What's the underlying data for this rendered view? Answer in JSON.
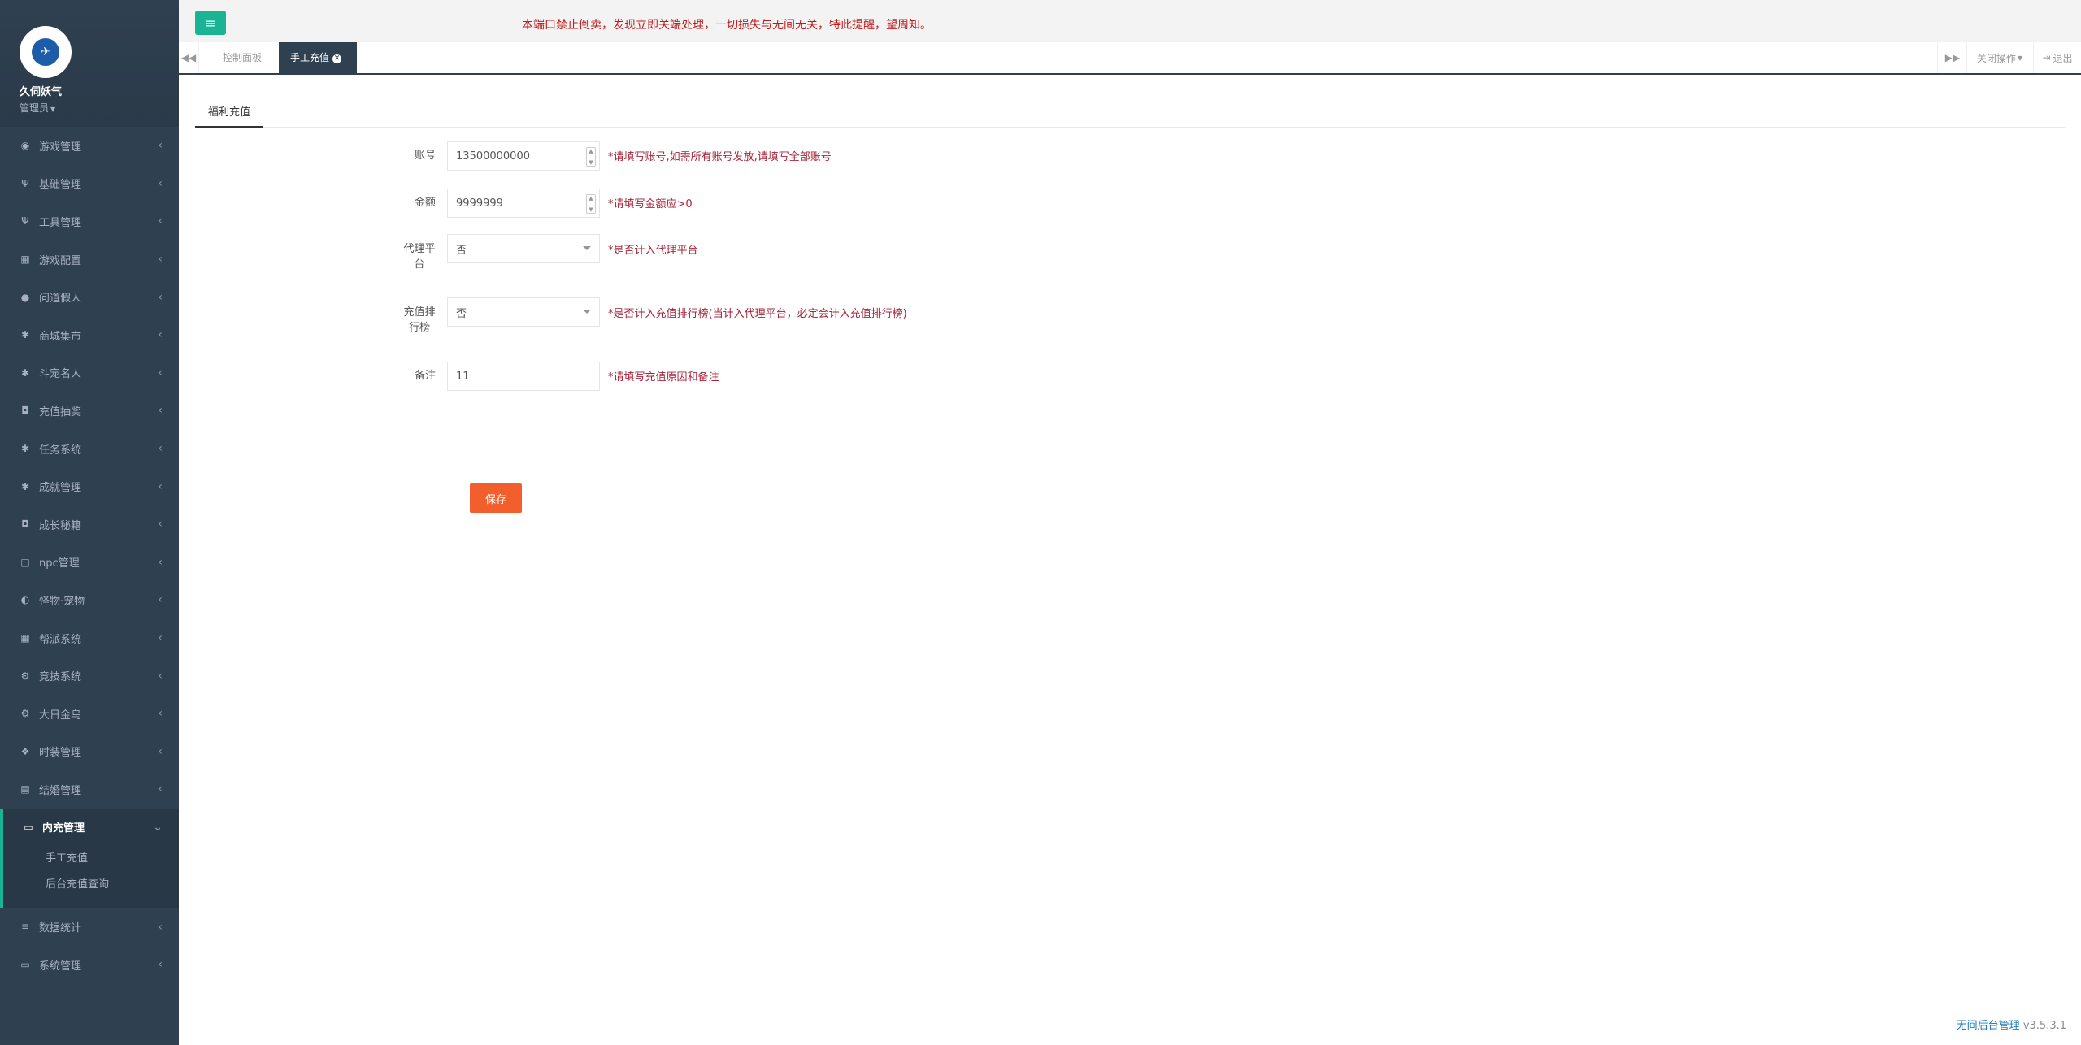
{
  "sidebar": {
    "profile": {
      "name": "久伺妖气",
      "role": "管理员"
    },
    "items": [
      {
        "icon": "gamepad-icon",
        "label": "游戏管理"
      },
      {
        "icon": "cutlery-icon",
        "label": "基础管理"
      },
      {
        "icon": "cutlery-icon",
        "label": "工具管理"
      },
      {
        "icon": "table-icon",
        "label": "游戏配置"
      },
      {
        "icon": "user-icon",
        "label": "问道假人"
      },
      {
        "icon": "gear-icon",
        "label": "商城集市"
      },
      {
        "icon": "gear-icon",
        "label": "斗宠名人"
      },
      {
        "icon": "money-icon",
        "label": "充值抽奖"
      },
      {
        "icon": "gear-icon",
        "label": "任务系统"
      },
      {
        "icon": "gear-icon",
        "label": "成就管理"
      },
      {
        "icon": "money-icon",
        "label": "成长秘籍"
      },
      {
        "icon": "square-icon",
        "label": "npc管理"
      },
      {
        "icon": "adjust-icon",
        "label": "怪物·宠物"
      },
      {
        "icon": "table-icon",
        "label": "帮派系统"
      },
      {
        "icon": "gears-icon",
        "label": "竞技系统"
      },
      {
        "icon": "gears-icon",
        "label": "大日金乌"
      },
      {
        "icon": "cubes-icon",
        "label": "时装管理"
      },
      {
        "icon": "calculator-icon",
        "label": "结婚管理"
      }
    ],
    "active_group": {
      "icon": "desktop-icon",
      "label": "内充管理",
      "children": [
        "手工充值",
        "后台充值查询"
      ]
    },
    "items_after": [
      {
        "icon": "database-icon",
        "label": "数据统计"
      },
      {
        "icon": "desktop-icon",
        "label": "系统管理"
      }
    ]
  },
  "topbar": {
    "notice": "本端口禁止倒卖，发现立即关端处理，一切损失与无间无关，特此提醒，望周知。"
  },
  "tabs": {
    "items": [
      "控制面板",
      "手工充值"
    ],
    "close_ops": "关闭操作",
    "logout": "退出"
  },
  "panel": {
    "tab": "福利充值",
    "fields": {
      "account": {
        "label": "账号",
        "value": "13500000000",
        "hint": "*请填写账号,如需所有账号发放,请填写全部账号"
      },
      "amount": {
        "label": "金额",
        "value": "9999999",
        "hint": "*请填写金额应>0"
      },
      "agent": {
        "label": "代理平台",
        "value": "否",
        "hint": "*是否计入代理平台"
      },
      "ranking": {
        "label": "充值排行榜",
        "value": "否",
        "hint": "*是否计入充值排行榜(当计入代理平台，必定会计入充值排行榜)"
      },
      "remark": {
        "label": "备注",
        "value": "11",
        "hint": "*请填写充值原因和备注"
      }
    },
    "save": "保存"
  },
  "footer": {
    "link": "无间后台管理",
    "version": "v3.5.3.1"
  },
  "colors": {
    "sidebar_bg": "#2f4050",
    "accent": "#1ab394",
    "notice": "#c21b1b",
    "save_button": "#f25f2c",
    "hint": "#a5243a"
  }
}
